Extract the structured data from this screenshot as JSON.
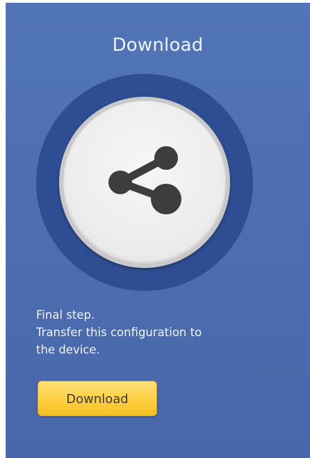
{
  "header": {
    "title": "Download"
  },
  "icon": {
    "name": "share-icon"
  },
  "description": {
    "line1": "Final step.",
    "line2": "Transfer this configuration to",
    "line3": "the device."
  },
  "actions": {
    "download_label": "Download"
  },
  "colors": {
    "panel_background": "#4f70b3",
    "ring": "#2f4d92",
    "button": "#ffd34a"
  }
}
